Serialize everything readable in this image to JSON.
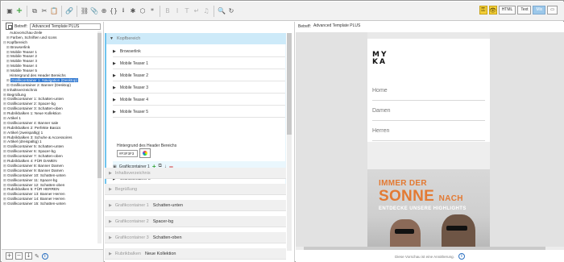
{
  "toolbar": {
    "buttons": [
      {
        "name": "save-icon",
        "glyph": "▣"
      },
      {
        "name": "add-icon",
        "glyph": "+"
      },
      {
        "name": "copy-icon",
        "glyph": "⧉"
      },
      {
        "name": "cut-icon",
        "glyph": "✂"
      },
      {
        "name": "paste-icon",
        "glyph": "📋"
      },
      {
        "name": "link-icon",
        "glyph": "🔗"
      },
      {
        "name": "unlink-icon",
        "glyph": "⛓"
      },
      {
        "name": "attach-icon",
        "glyph": "📎"
      },
      {
        "name": "globe-icon",
        "glyph": "⊕"
      },
      {
        "name": "brackets-icon",
        "glyph": "{}"
      },
      {
        "name": "download-icon",
        "glyph": "⭳"
      },
      {
        "name": "puzzle-icon",
        "glyph": "✱"
      },
      {
        "name": "cube-icon",
        "glyph": "⬡"
      },
      {
        "name": "asterisk-icon",
        "glyph": "*"
      },
      {
        "name": "bold-icon",
        "glyph": "B"
      },
      {
        "name": "italic-icon",
        "glyph": "I"
      },
      {
        "name": "text-height-icon",
        "glyph": "T"
      },
      {
        "name": "return-icon",
        "glyph": "↵"
      },
      {
        "name": "mic-icon",
        "glyph": "♫"
      },
      {
        "name": "search-icon",
        "glyph": "🔍"
      },
      {
        "name": "refresh-icon",
        "glyph": "↻"
      }
    ],
    "view_html": "HTML",
    "view_text": "Text",
    "view_mixed": "Mix"
  },
  "left": {
    "betreff_label": "Betreff:",
    "betreff_value": "Advanced Template PLUS",
    "tree": [
      {
        "text": "Autovorschau-Zeile",
        "indent": 2,
        "exp": ""
      },
      {
        "text": "Farben, Schriften und Icons",
        "indent": 1,
        "exp": "⊞"
      },
      {
        "text": "Kopfbereich",
        "indent": 0,
        "exp": "⊟"
      },
      {
        "text": "Browserlink",
        "indent": 1,
        "exp": "⊞"
      },
      {
        "text": "Mobile Teaser 1",
        "indent": 1,
        "exp": "⊞"
      },
      {
        "text": "Mobile Teaser 2",
        "indent": 1,
        "exp": "⊞"
      },
      {
        "text": "Mobile Teaser 3",
        "indent": 1,
        "exp": "⊞"
      },
      {
        "text": "Mobile Teaser 4",
        "indent": 1,
        "exp": "⊞"
      },
      {
        "text": "Mobile Teaser 5",
        "indent": 1,
        "exp": "⊞"
      },
      {
        "text": "Hintergrund des Header Bereichs",
        "indent": 2,
        "exp": ""
      },
      {
        "text": "Grafikcontainer 1: Navigation (Desktop)",
        "indent": 1,
        "exp": "⊞",
        "selected": true
      },
      {
        "text": "Grafikcontainer 2: Banner (Desktop)",
        "indent": 1,
        "exp": "⊞"
      },
      {
        "text": "Inhaltsverzeichnis",
        "indent": 0,
        "exp": "⊞"
      },
      {
        "text": "Begrüßung",
        "indent": 0,
        "exp": "⊞"
      },
      {
        "text": "Grafikcontainer 1: Schatten-unten",
        "indent": 0,
        "exp": "⊞"
      },
      {
        "text": "Grafikcontainer 2: Spacer-bg",
        "indent": 0,
        "exp": "⊞"
      },
      {
        "text": "Grafikcontainer 3: Schatten-oben",
        "indent": 0,
        "exp": "⊞"
      },
      {
        "text": "Rubrikbalken 1: Neue Kollektion",
        "indent": 0,
        "exp": "⊞"
      },
      {
        "text": "Artikel 1",
        "indent": 0,
        "exp": "⊞"
      },
      {
        "text": "Grafikcontainer 4: Banner sale",
        "indent": 0,
        "exp": "⊞"
      },
      {
        "text": "Rubrikbalken 2: Perfekte Basics",
        "indent": 0,
        "exp": "⊞"
      },
      {
        "text": "Artikel (zweispaltig) 1",
        "indent": 0,
        "exp": "⊞"
      },
      {
        "text": "Rubrikbalken 3: Schuhe & Accessoires",
        "indent": 0,
        "exp": "⊞"
      },
      {
        "text": "Artikel (dreispaltig) 1",
        "indent": 0,
        "exp": "⊞"
      },
      {
        "text": "Grafikcontainer 5: Schatten-unten",
        "indent": 0,
        "exp": "⊞"
      },
      {
        "text": "Grafikcontainer 6: Spacer-bg",
        "indent": 0,
        "exp": "⊞"
      },
      {
        "text": "Grafikcontainer 7: Schatten-oben",
        "indent": 0,
        "exp": "⊞"
      },
      {
        "text": "Rubrikbalken 4: FÜR DAMEN",
        "indent": 0,
        "exp": "⊞"
      },
      {
        "text": "Grafikcontainer 8: Banner Damen",
        "indent": 0,
        "exp": "⊞"
      },
      {
        "text": "Grafikcontainer 9: Banner Damen",
        "indent": 0,
        "exp": "⊞"
      },
      {
        "text": "Grafikcontainer 10: Schatten-unten",
        "indent": 0,
        "exp": "⊞"
      },
      {
        "text": "Grafikcontainer 11: Spacer-bg",
        "indent": 0,
        "exp": "⊞"
      },
      {
        "text": "Grafikcontainer 12: Schatten-oben",
        "indent": 0,
        "exp": "⊞"
      },
      {
        "text": "Rubrikbalken 5: FÜR HERREN",
        "indent": 0,
        "exp": "⊞"
      },
      {
        "text": "Grafikcontainer 13: Banner Herren",
        "indent": 0,
        "exp": "⊞"
      },
      {
        "text": "Grafikcontainer 14: Banner Herren",
        "indent": 0,
        "exp": "⊞"
      },
      {
        "text": "Grafikcontainer 15: Schatten-unten",
        "indent": 0,
        "exp": "⊞"
      }
    ]
  },
  "mid": {
    "kopf_label": "Kopfbereich",
    "rows": [
      {
        "label": "Browserlink"
      },
      {
        "label": "Mobile Teaser 1"
      },
      {
        "label": "Mobile Teaser 2"
      },
      {
        "label": "Mobile Teaser 3"
      },
      {
        "label": "Mobile Teaser 4"
      },
      {
        "label": "Mobile Teaser 5"
      }
    ],
    "header_bg_label": "Hintergrund des Header Bereichs",
    "header_bg_value": "#F3F3F3",
    "grafik1_label": "Grafikcontainer 1",
    "grafik2_label": "Grafikcontainer 2",
    "collapsed": [
      {
        "label": "Inhaltsverzeichnis",
        "value": ""
      },
      {
        "label": "Begrüßung",
        "value": ""
      },
      {
        "label": "Grafikcontainer 1",
        "value": "Schatten-unten"
      },
      {
        "label": "Grafikcontainer 2",
        "value": "Spacer-bg"
      },
      {
        "label": "Grafikcontainer 3",
        "value": "Schatten-oben"
      },
      {
        "label": "Rubrikbalken",
        "value": "Neue Kollektion"
      }
    ]
  },
  "right": {
    "betreff_label": "Betreff:",
    "betreff_value": "Advanced Template PLUS",
    "logo_line1": "MY",
    "logo_line2": "KA",
    "nav": [
      "Home",
      "Damen",
      "Herren"
    ],
    "banner_line1": "IMMER DER",
    "banner_line2": "SONNE",
    "banner_line2_small": "NACH",
    "banner_line3": "ENTDECKE UNSERE HIGHLIGHTS",
    "footer_note": "Diese Vorschau ist eine Annäherung."
  }
}
